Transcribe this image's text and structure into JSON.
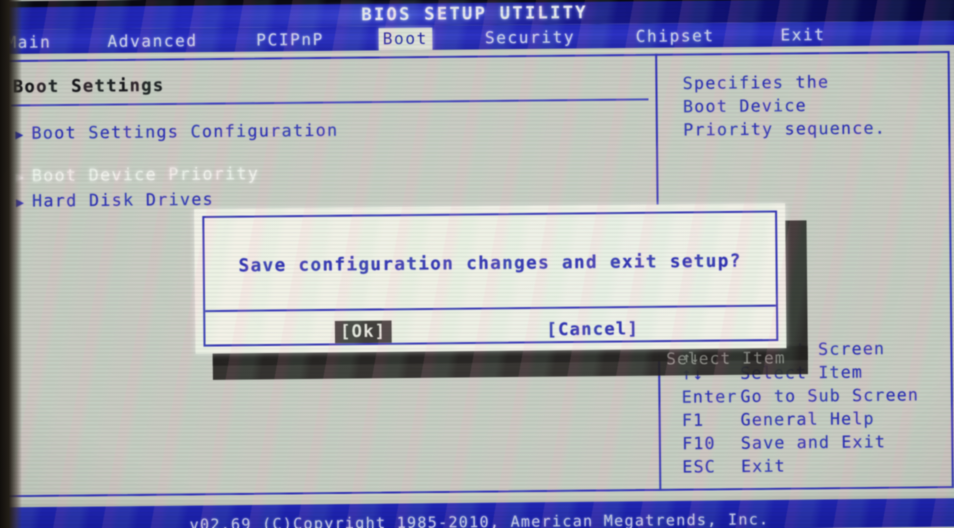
{
  "window": {
    "title": "BIOS SETUP UTILITY"
  },
  "menubar": {
    "items": [
      {
        "label": "Main",
        "active": false
      },
      {
        "label": "Advanced",
        "active": false
      },
      {
        "label": "PCIPnP",
        "active": false
      },
      {
        "label": "Boot",
        "active": true
      },
      {
        "label": "Security",
        "active": false
      },
      {
        "label": "Chipset",
        "active": false
      },
      {
        "label": "Exit",
        "active": false
      }
    ]
  },
  "main": {
    "section_title": "Boot Settings",
    "options": [
      {
        "arrow": "▶",
        "label": "Boot Settings Configuration",
        "selected": false
      },
      {
        "arrow": "▶",
        "label": "Boot Device Priority",
        "selected": true
      },
      {
        "arrow": "▶",
        "label": "Hard Disk Drives",
        "selected": false
      }
    ]
  },
  "help": {
    "lines": [
      "Specifies the",
      "Boot Device",
      "Priority sequence."
    ]
  },
  "legend": {
    "rows": [
      {
        "key": "↔",
        "desc": "Select Screen",
        "obscured": true
      },
      {
        "key": "↑↓",
        "desc": "Select Item",
        "obscured": true
      },
      {
        "key": "Enter",
        "desc": "Go to Sub Screen",
        "obscured": false
      },
      {
        "key": "F1",
        "desc": "General Help",
        "obscured": false
      },
      {
        "key": "F10",
        "desc": "Save and Exit",
        "obscured": false
      },
      {
        "key": "ESC",
        "desc": "Exit",
        "obscured": false
      }
    ]
  },
  "dialog": {
    "message": "Save configuration changes and exit setup?",
    "ok_label": "[Ok]",
    "cancel_label": "[Cancel]",
    "selected_button": "ok"
  },
  "statusbar": {
    "copyright": "v02.69 (C)Copyright 1985-2010, American Megatrends, Inc."
  },
  "colors": {
    "screen_bg": "#c9ccc3",
    "menubar_blue": "#2026b4",
    "text_blue": "#2b2fb4",
    "border_blue": "#2f30b8",
    "dialog_bg": "#f2f2e8",
    "selected_bg": "#3b3936",
    "title_text": "#e9eaf2"
  }
}
